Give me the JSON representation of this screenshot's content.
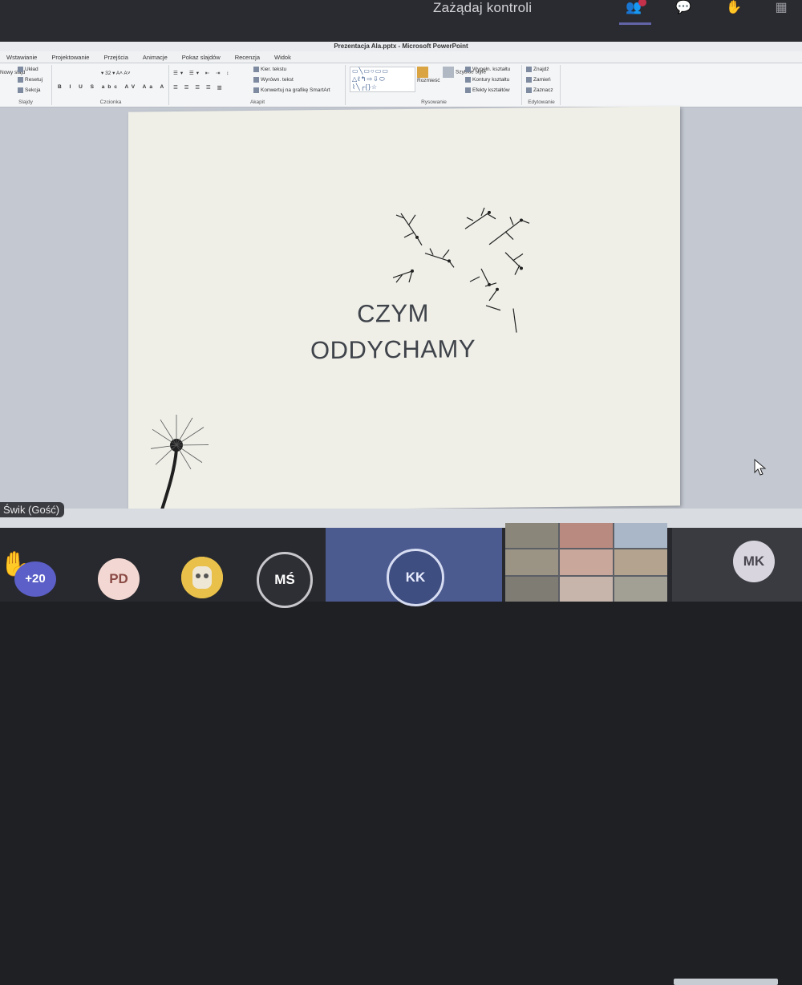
{
  "teams": {
    "request_control": "Zażądaj kontroli",
    "icons": [
      "people-icon",
      "chat-icon",
      "reactions-icon",
      "more-icon"
    ]
  },
  "powerpoint": {
    "window_title": "Prezentacja Ala.pptx - Microsoft PowerPoint",
    "tabs": [
      "Wstawianie",
      "Projektowanie",
      "Przejścia",
      "Animacje",
      "Pokaz slajdów",
      "Recenzja",
      "Widok"
    ],
    "ribbon": {
      "slides_group": {
        "label": "Slajdy",
        "new_slide": "Nowy slajd",
        "layout": "Układ",
        "reset": "Resetuj",
        "section": "Sekcja"
      },
      "font_group": {
        "label": "Czcionka",
        "font_size": "32"
      },
      "paragraph_group": {
        "label": "Akapit",
        "text_direction": "Kier. tekstu",
        "align_text": "Wyrówn. tekst",
        "smartart": "Konwertuj na grafikę SmartArt"
      },
      "drawing_group": {
        "label": "Rysowanie",
        "arrange": "Rozmieść",
        "quick_styles": "Szybkie style",
        "fill": "Wypełn. kształtu",
        "outline": "Kontury kształtu",
        "effects": "Efekty kształtów"
      },
      "editing_group": {
        "label": "Edytowanie",
        "find": "Znajdź",
        "replace": "Zamień",
        "select": "Zaznacz"
      }
    },
    "slide": {
      "title_line1": "CZYM",
      "title_line2": "ODDYCHAMY"
    }
  },
  "guest_label": "Świk (Gość)",
  "participants": {
    "raised_count": "+20",
    "avatars": [
      {
        "initials": "PD",
        "bg": "#f3d7d2",
        "fg": "#8a4a45"
      },
      {
        "initials": "MŚ",
        "bg": "#2e2f34",
        "fg": "#ffffff"
      },
      {
        "initials": "KK",
        "bg": "#3f4e80",
        "fg": "#e8ecff"
      },
      {
        "initials": "MK",
        "bg": "#d8d5de",
        "fg": "#4a4650"
      }
    ]
  }
}
